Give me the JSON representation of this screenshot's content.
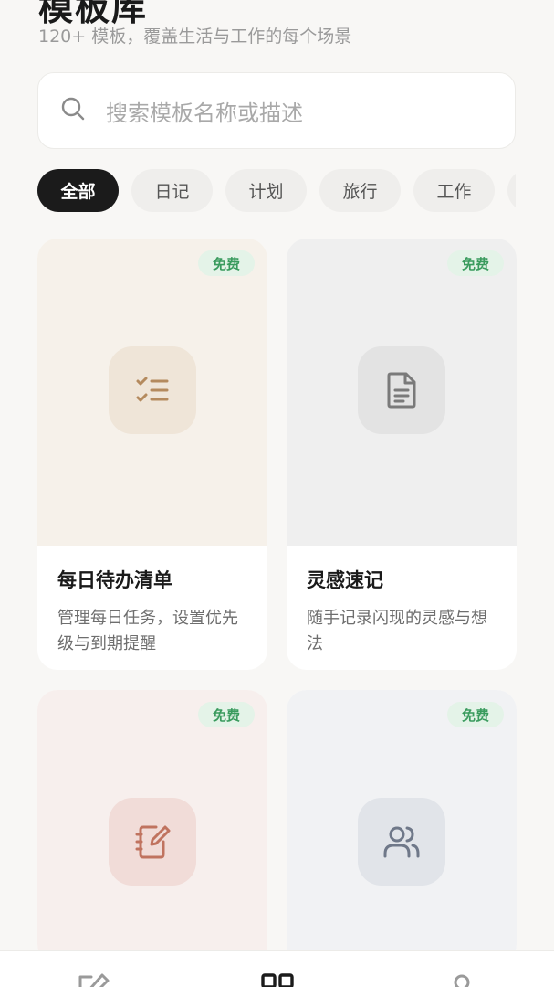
{
  "header": {
    "title": "模板库",
    "subtitle": "120+ 模板，覆盖生活与工作的每个场景"
  },
  "search": {
    "placeholder": "搜索模板名称或描述"
  },
  "categories": [
    "全部",
    "日记",
    "计划",
    "旅行",
    "工作"
  ],
  "active_category": "全部",
  "cards": [
    {
      "badge": "免费",
      "title": "每日待办清单",
      "desc": "管理每日任务，设置优先级与到期提醒",
      "icon": "checklist-icon",
      "tint": "#efe5d8",
      "accent": "#b48a5e"
    },
    {
      "badge": "免费",
      "title": "灵感速记",
      "desc": "随手记录闪现的灵感与想法",
      "icon": "document-icon",
      "tint": "#e6e6e6",
      "accent": "#7a7a7a"
    },
    {
      "badge": "免费",
      "title": "",
      "desc": "",
      "icon": "notebook-pen-icon",
      "tint": "#f1dcd8",
      "accent": "#c0735f"
    },
    {
      "badge": "免费",
      "title": "",
      "desc": "",
      "icon": "users-icon",
      "tint": "#e1e4e9",
      "accent": "#6f7889"
    }
  ],
  "bottom_nav": [
    "edit-icon",
    "grid-icon",
    "profile-icon"
  ]
}
